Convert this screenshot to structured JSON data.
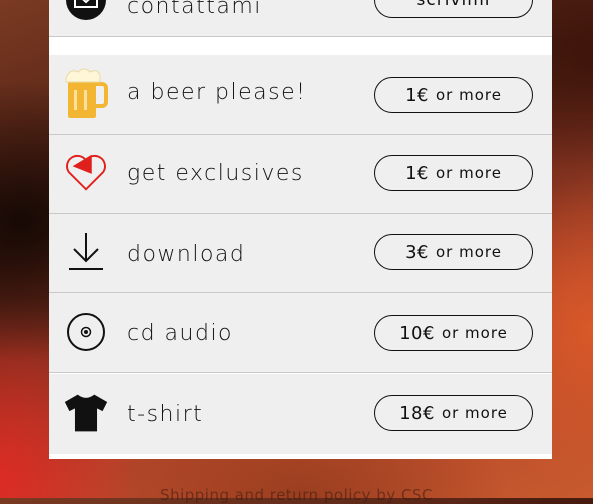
{
  "contact": {
    "label": "contattami",
    "button": "scrivimi",
    "icon": "envelope-icon"
  },
  "items": [
    {
      "label": "a beer please!",
      "price": "1€",
      "suffix": "or more",
      "icon": "beer-mug-icon"
    },
    {
      "label": "get exclusives",
      "price": "1€",
      "suffix": "or more",
      "icon": "heart-gift-icon"
    },
    {
      "label": "download",
      "price": "3€",
      "suffix": "or more",
      "icon": "download-icon"
    },
    {
      "label": "cd audio",
      "price": "10€",
      "suffix": "or more",
      "icon": "cd-icon"
    },
    {
      "label": "t-shirt",
      "price": "18€",
      "suffix": "or more",
      "icon": "tshirt-icon"
    }
  ],
  "footer": {
    "text": "Shipping and return policy by CSC"
  },
  "colors": {
    "panel_row": "#efefef",
    "text": "#111111",
    "heart_red": "#e0201c",
    "beer": "#f2b632"
  }
}
